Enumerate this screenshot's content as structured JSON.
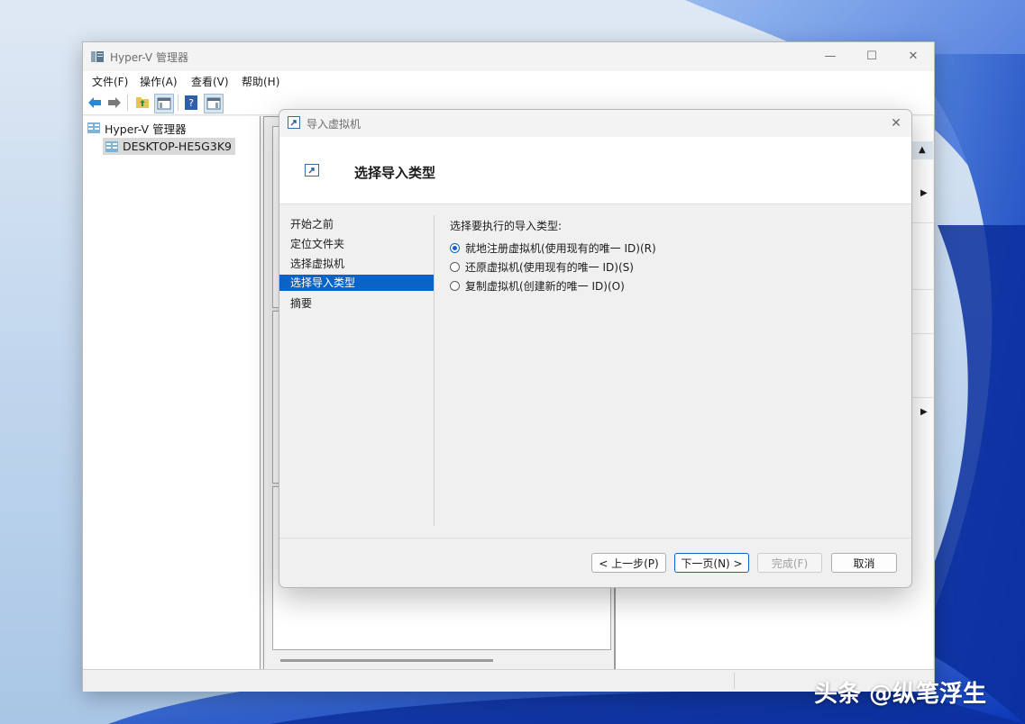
{
  "main_window": {
    "title": "Hyper-V 管理器",
    "controls": {
      "minimize": "—",
      "maximize": "☐",
      "close": "✕"
    },
    "menu": [
      "文件(F)",
      "操作(A)",
      "查看(V)",
      "帮助(H)"
    ],
    "toolbar_icons": [
      "back-arrow-icon",
      "forward-arrow-icon",
      "folder-up-icon",
      "console-tree-icon",
      "help-icon",
      "action-pane-icon"
    ],
    "tree": {
      "root": "Hyper-V 管理器",
      "server": "DESKTOP-HE5G3K9"
    }
  },
  "dialog": {
    "title": "导入虚拟机",
    "close": "✕",
    "header_title": "选择导入类型",
    "steps": [
      "开始之前",
      "定位文件夹",
      "选择虚拟机",
      "选择导入类型",
      "摘要"
    ],
    "active_step": 3,
    "prompt": "选择要执行的导入类型:",
    "options": [
      {
        "label": "就地注册虚拟机(使用现有的唯一 ID)(R)",
        "checked": true
      },
      {
        "label": "还原虚拟机(使用现有的唯一 ID)(S)",
        "checked": false
      },
      {
        "label": "复制虚拟机(创建新的唯一 ID)(O)",
        "checked": false
      }
    ],
    "buttons": {
      "previous": "< 上一步(P)",
      "next": "下一页(N) >",
      "finish": "完成(F)",
      "cancel": "取消"
    }
  },
  "watermark": "头条 @纵笔浮生",
  "colors": {
    "accent": "#0a64c8",
    "window_bg": "#f0f0f0"
  }
}
